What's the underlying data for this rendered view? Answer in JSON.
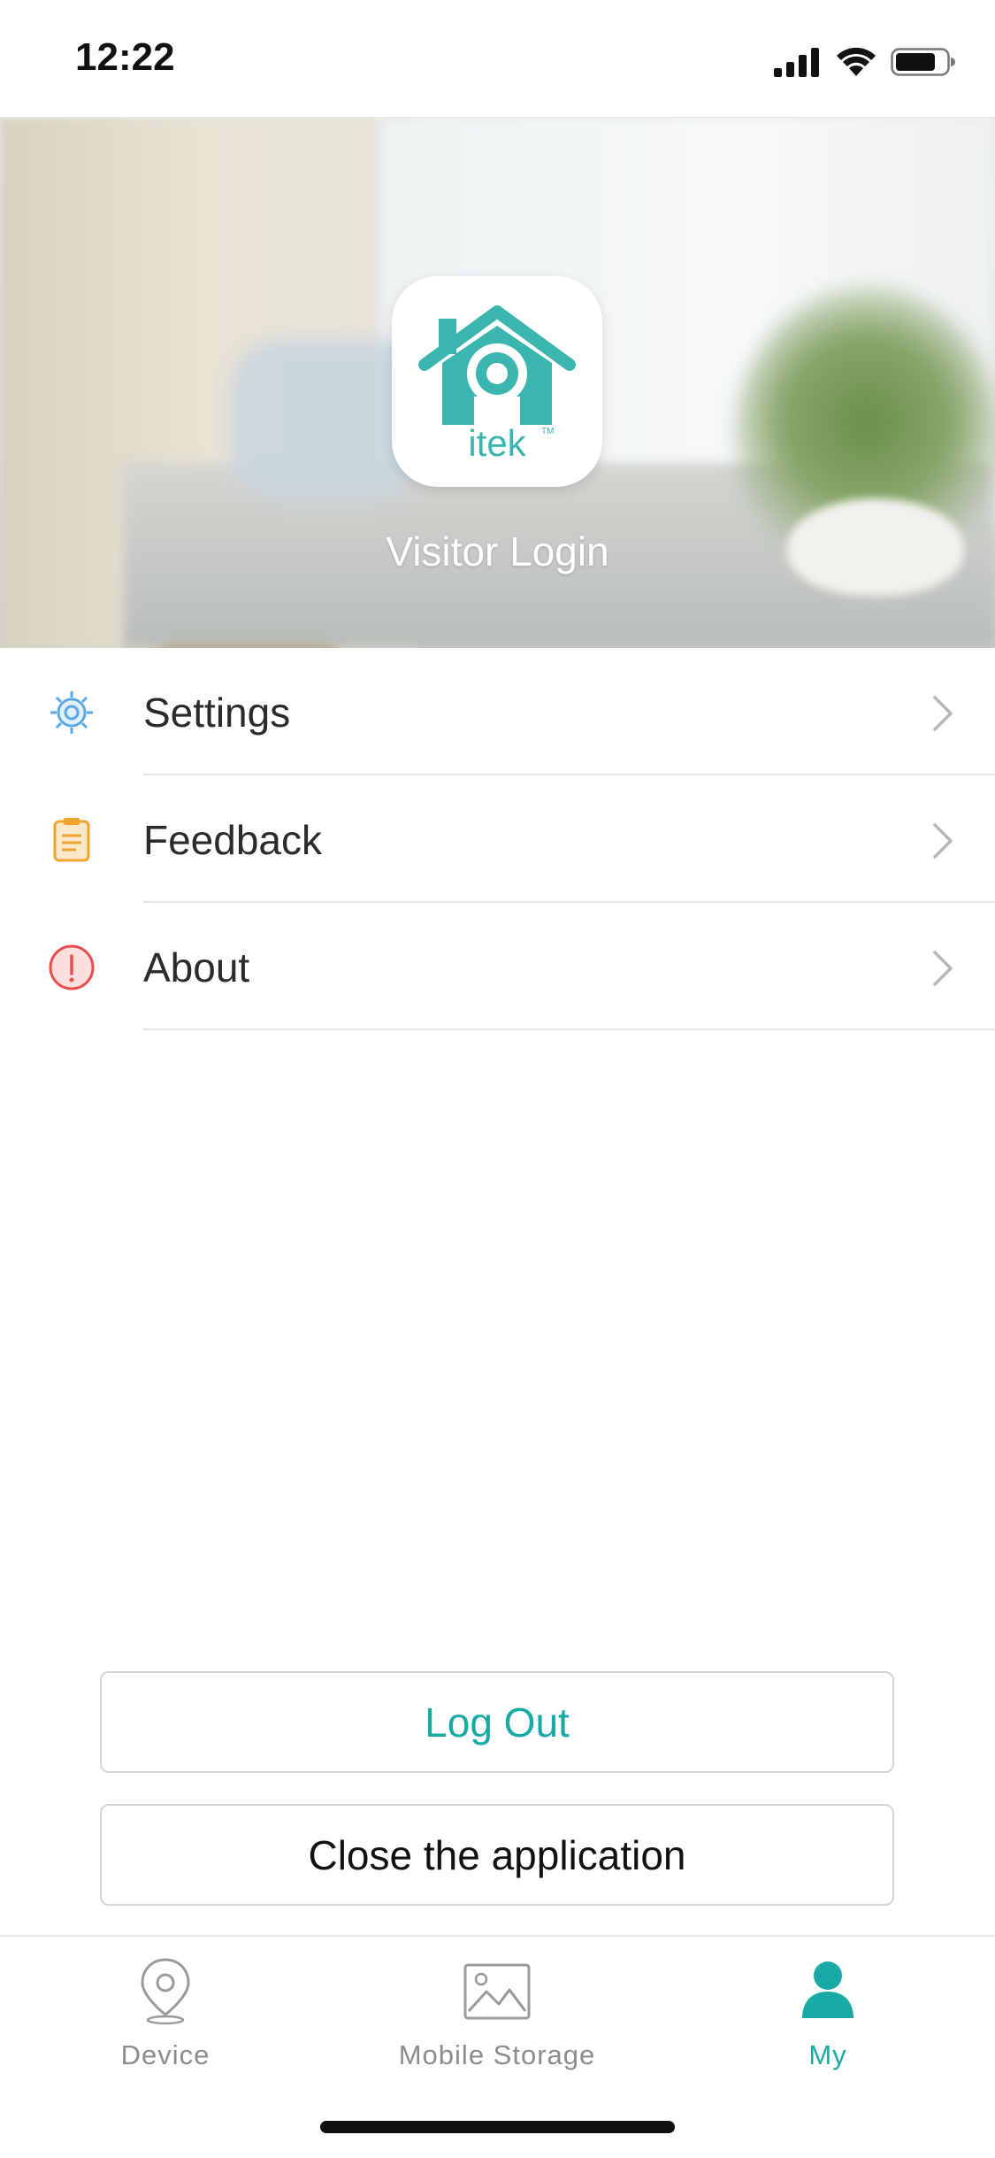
{
  "status_bar": {
    "time": "12:22"
  },
  "profile": {
    "logo_text": "itek",
    "logo_tm": "TM",
    "login_label": "Visitor Login"
  },
  "menu": {
    "items": [
      {
        "label": "Settings",
        "icon": "gear-icon",
        "color": "#5aa9e6"
      },
      {
        "label": "Feedback",
        "icon": "clipboard-icon",
        "color": "#f0a430"
      },
      {
        "label": "About",
        "icon": "info-icon",
        "color": "#e84d4d"
      }
    ]
  },
  "actions": {
    "logout_label": "Log Out",
    "close_label": "Close the application"
  },
  "tab_bar": {
    "tabs": [
      {
        "label": "Device",
        "icon": "location-pin-icon",
        "active": false
      },
      {
        "label": "Mobile Storage",
        "icon": "image-icon",
        "active": false
      },
      {
        "label": "My",
        "icon": "person-icon",
        "active": true
      }
    ]
  },
  "colors": {
    "accent": "#19aaa5",
    "brand": "#3bb6ae"
  }
}
